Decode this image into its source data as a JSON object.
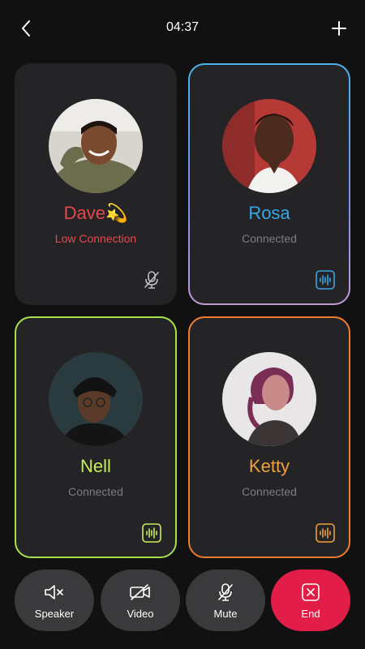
{
  "header": {
    "time": "04:37"
  },
  "participants": [
    {
      "name": "Dave💫",
      "status": "Low Connection",
      "name_color": "#e5484d",
      "status_color": "#e5484d",
      "mic": "muted"
    },
    {
      "name": "Rosa",
      "status": "Connected",
      "name_color": "#37a6e6",
      "status_color": "#7d7d80",
      "mic": "speaking"
    },
    {
      "name": "Nell",
      "status": "Connected",
      "name_color": "#c8ee5a",
      "status_color": "#7d7d80",
      "mic": "speaking"
    },
    {
      "name": "Ketty",
      "status": "Connected",
      "name_color": "#f0a03c",
      "status_color": "#7d7d80",
      "mic": "speaking"
    }
  ],
  "controls": {
    "speaker_label": "Speaker",
    "video_label": "Video",
    "mute_label": "Mute",
    "end_label": "End"
  },
  "colors": {
    "background": "#111111",
    "card": "#242426",
    "control": "#3a3a3c",
    "end": "#e11d48"
  }
}
